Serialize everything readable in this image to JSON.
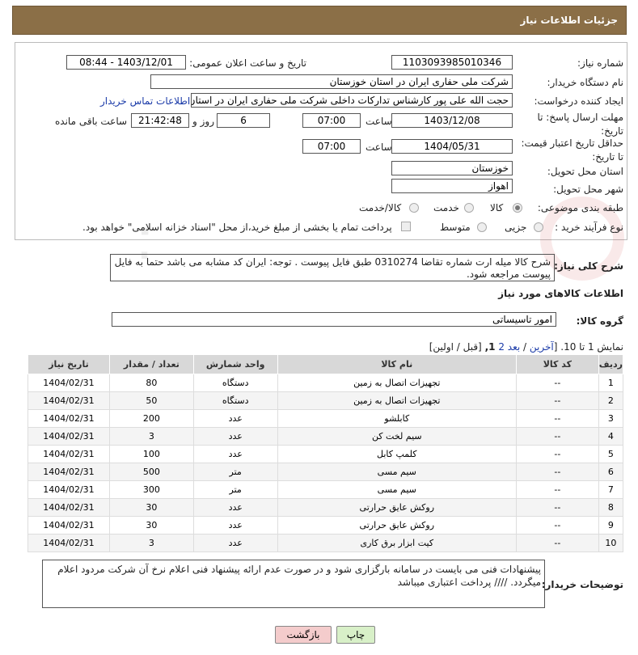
{
  "header": {
    "title": "جزئیات اطلاعات نیاز"
  },
  "form": {
    "need_number_label": "شماره نیاز:",
    "need_number": "1103093985010346",
    "announce_label": "تاریخ و ساعت اعلان عمومی:",
    "announce_value": "1403/12/01 - 08:44",
    "buyer_label": "نام دستگاه خریدار:",
    "buyer_value": "شرکت ملی حفاری ایران در استان خوزستان",
    "creator_label": "ایجاد کننده درخواست:",
    "creator_value": "حجت الله علی پور کارشناس تدارکات داخلی شرکت ملی حفاری ایران در استان",
    "contact_link": "اطلاعات تماس خریدار",
    "deadline_label": "مهلت ارسال پاسخ: تا تاریخ:",
    "deadline_date": "1403/12/08",
    "time_label": "ساعت",
    "deadline_time": "07:00",
    "days_value": "6",
    "days_label": "روز و",
    "remaining_time": "21:42:48",
    "remaining_label": "ساعت باقی مانده",
    "validity_label": "حداقل تاریخ اعتبار قیمت: تا تاریخ:",
    "validity_date": "1404/05/31",
    "validity_time": "07:00",
    "province_label": "استان محل تحویل:",
    "province_value": "خوزستان",
    "city_label": "شهر محل تحویل:",
    "city_value": "اهواز",
    "category_label": "طبقه بندی موضوعی:",
    "category_options": [
      "کالا",
      "خدمت",
      "کالا/خدمت"
    ],
    "process_label": "نوع فرآیند خرید :",
    "process_options": [
      "جزیی",
      "متوسط"
    ],
    "payment_note": "پرداخت تمام یا بخشی از مبلغ خرید،از محل \"اسناد خزانه اسلامی\" خواهد بود."
  },
  "description": {
    "label": "شرح کلی نیاز:",
    "text": "شرح کالا میله ارت شماره تقاضا 0310274 طبق فایل پیوست . توجه: ایران کد مشابه می باشد حتما به فایل پیوست مراجعه شود."
  },
  "goods": {
    "section_title": "اطلاعات کالاهای مورد نیاز",
    "group_label": "گروه کالا:",
    "group_value": "امور تاسیساتی",
    "pagination_prefix": "نمایش 1 تا 10. [",
    "pag_last": "آخرین",
    "pag_sep1": " / ",
    "pag_next": "بعد",
    "pag_page2": "2",
    "pag_page1": "1",
    "pag_suffix": " [قبل / اولین]",
    "columns": [
      "ردیف",
      "کد کالا",
      "نام کالا",
      "واحد شمارش",
      "تعداد / مقدار",
      "تاریخ نیاز"
    ],
    "rows": [
      [
        "1",
        "--",
        "تجهیزات اتصال به زمین",
        "دستگاه",
        "80",
        "1404/02/31"
      ],
      [
        "2",
        "--",
        "تجهیزات اتصال به زمین",
        "دستگاه",
        "50",
        "1404/02/31"
      ],
      [
        "3",
        "--",
        "کابلشو",
        "عدد",
        "200",
        "1404/02/31"
      ],
      [
        "4",
        "--",
        "سیم لخت کن",
        "عدد",
        "3",
        "1404/02/31"
      ],
      [
        "5",
        "--",
        "کلمپ کابل",
        "عدد",
        "100",
        "1404/02/31"
      ],
      [
        "6",
        "--",
        "سیم مسی",
        "متر",
        "500",
        "1404/02/31"
      ],
      [
        "7",
        "--",
        "سیم مسی",
        "متر",
        "300",
        "1404/02/31"
      ],
      [
        "8",
        "--",
        "روکش عایق حرارتی",
        "عدد",
        "30",
        "1404/02/31"
      ],
      [
        "9",
        "--",
        "روکش عایق حرارتی",
        "عدد",
        "30",
        "1404/02/31"
      ],
      [
        "10",
        "--",
        "کیت ابزار برق کاری",
        "عدد",
        "3",
        "1404/02/31"
      ]
    ]
  },
  "buyer_notes": {
    "label": "توضیحات خریدار:",
    "text": "پیشنهادات فنی می بایست در سامانه بارگزاری شود و در صورت عدم ارائه پیشنهاد فنی اعلام نرخ آن شرکت مردود اعلام میگردد.  //// پرداخت اعتباری میباشد"
  },
  "buttons": {
    "print": "چاپ",
    "back": "بازگشت"
  },
  "colors": {
    "header_bg": "#8b6f47",
    "print_btn": "#d8f0c8",
    "back_btn": "#f4cccc"
  }
}
